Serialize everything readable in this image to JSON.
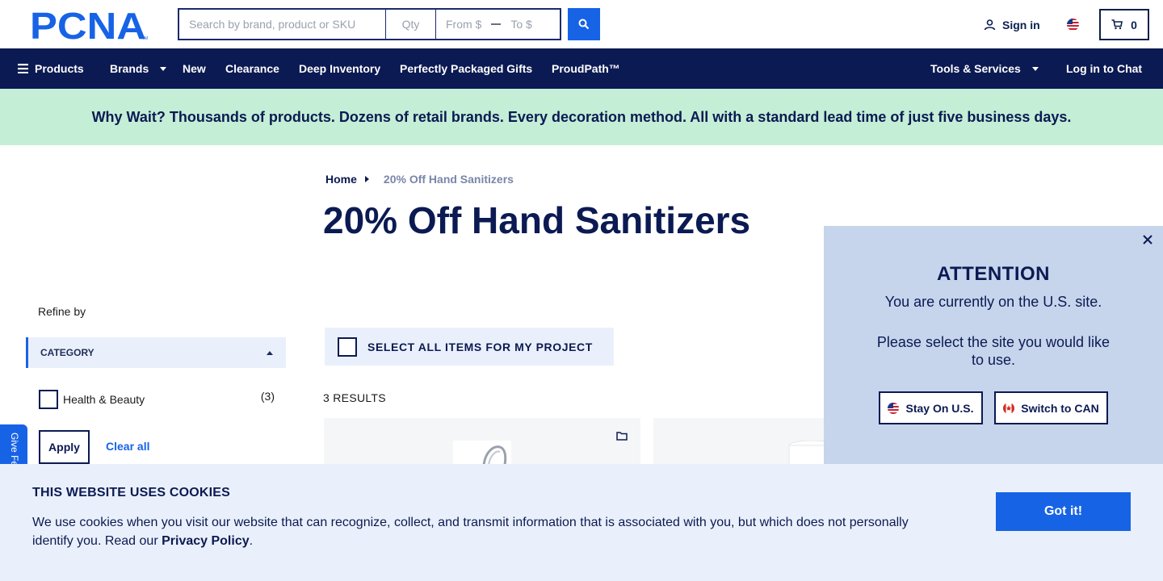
{
  "header": {
    "logo_text": "PCNA",
    "search_placeholder": "Search by brand, product or SKU",
    "qty_placeholder": "Qty",
    "from_placeholder": "From $",
    "to_placeholder": "To $",
    "sign_in": "Sign in",
    "cart_count": "0"
  },
  "nav": {
    "products": "Products",
    "brands": "Brands",
    "new": "New",
    "clearance": "Clearance",
    "deep_inventory": "Deep Inventory",
    "gifts": "Perfectly Packaged Gifts",
    "proudpath": "ProudPath™",
    "tools": "Tools & Services",
    "chat": "Log in to Chat"
  },
  "promo": "Why Wait? Thousands of products. Dozens of retail brands. Every decoration method. All with a standard lead time of just five business days.",
  "breadcrumb": {
    "home": "Home",
    "current": "20% Off Hand Sanitizers"
  },
  "page_title": "20% Off Hand Sanitizers",
  "sidebar": {
    "refine_by": "Refine by",
    "category_label": "CATEGORY",
    "facets": [
      {
        "label": "Health & Beauty",
        "count": "(3)"
      }
    ],
    "apply": "Apply",
    "clear_all": "Clear all",
    "feedback": "Give Fe"
  },
  "main": {
    "select_all": "SELECT ALL ITEMS FOR MY PROJECT",
    "results": "3 RESULTS"
  },
  "attention": {
    "title": "ATTENTION",
    "line1": "You are currently on the U.S. site.",
    "line2": "Please select the site you would like to use.",
    "stay_us": "Stay On U.S.",
    "switch_can": "Switch to CAN"
  },
  "cookies": {
    "title": "THIS WEBSITE USES COOKIES",
    "text": "We use cookies when you visit our website that can recognize, collect, and transmit information that is associated with you, but which does not personally identify you. Read our ",
    "link": "Privacy Policy",
    "text_end": ".",
    "button": "Got it!"
  },
  "colors": {
    "navy": "#0b1a52",
    "accent_blue": "#1763e6",
    "promo_green": "#c4eed6",
    "panel_blue": "#c6d5ec",
    "light_blue": "#eaf0fb"
  }
}
